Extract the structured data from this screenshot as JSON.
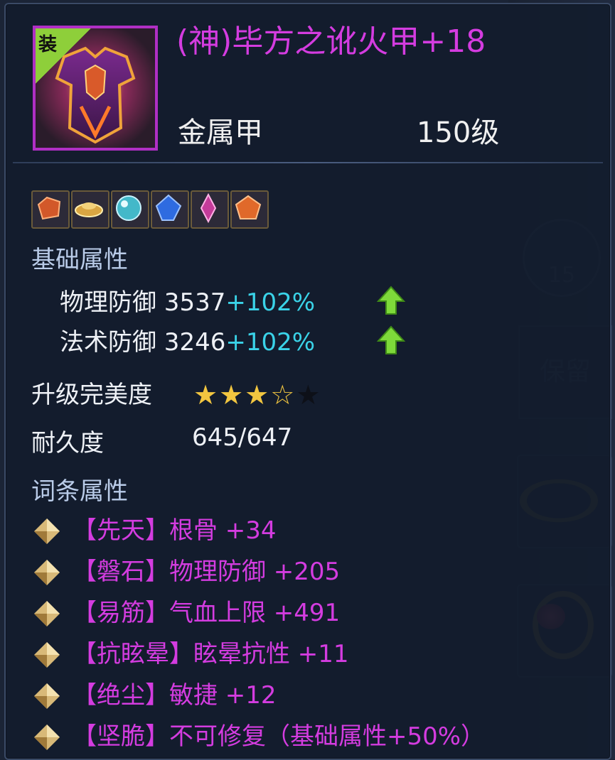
{
  "item": {
    "name": "(神)毕方之讹火甲+18",
    "name_color": "#d43ce0",
    "type": "金属甲",
    "level": "150级",
    "badge": "装"
  },
  "gems": [
    {
      "name": "orange-gem",
      "color": "#d2582a"
    },
    {
      "name": "gold-ingot-gem",
      "color": "#d9a642"
    },
    {
      "name": "teal-orb-gem",
      "color": "#43b8c9"
    },
    {
      "name": "blue-crystal-gem",
      "color": "#2e6be0"
    },
    {
      "name": "pink-crystal-gem",
      "color": "#c43b9a"
    },
    {
      "name": "orange-pentagon-gem",
      "color": "#e0692a"
    }
  ],
  "base_attributes": {
    "title": "基础属性",
    "rows": [
      {
        "label": "物理防御 3537",
        "bonus": "+102%"
      },
      {
        "label": "法术防御 3246",
        "bonus": "+102%"
      }
    ]
  },
  "perfection": {
    "label": "升级完美度",
    "stars_full": 3,
    "stars_outline": 1,
    "stars_dark": 1
  },
  "durability": {
    "label": "耐久度",
    "value": "645/647"
  },
  "affixes": {
    "title": "词条属性",
    "rows": [
      "【先天】根骨 +34",
      "【磐石】物理防御 +205",
      "【易筋】气血上限 +491",
      "【抗眩晕】眩晕抗性 +11",
      "【绝尘】敏捷 +12",
      "【坚脆】不可修复（基础属性+50%）"
    ]
  },
  "background": {
    "counter": "15",
    "keep_button": "保留"
  },
  "colors": {
    "affix": "#d43ce0",
    "bonus": "#3ad3e8",
    "arrow": "#7ed93a",
    "star": "#f2c640"
  }
}
